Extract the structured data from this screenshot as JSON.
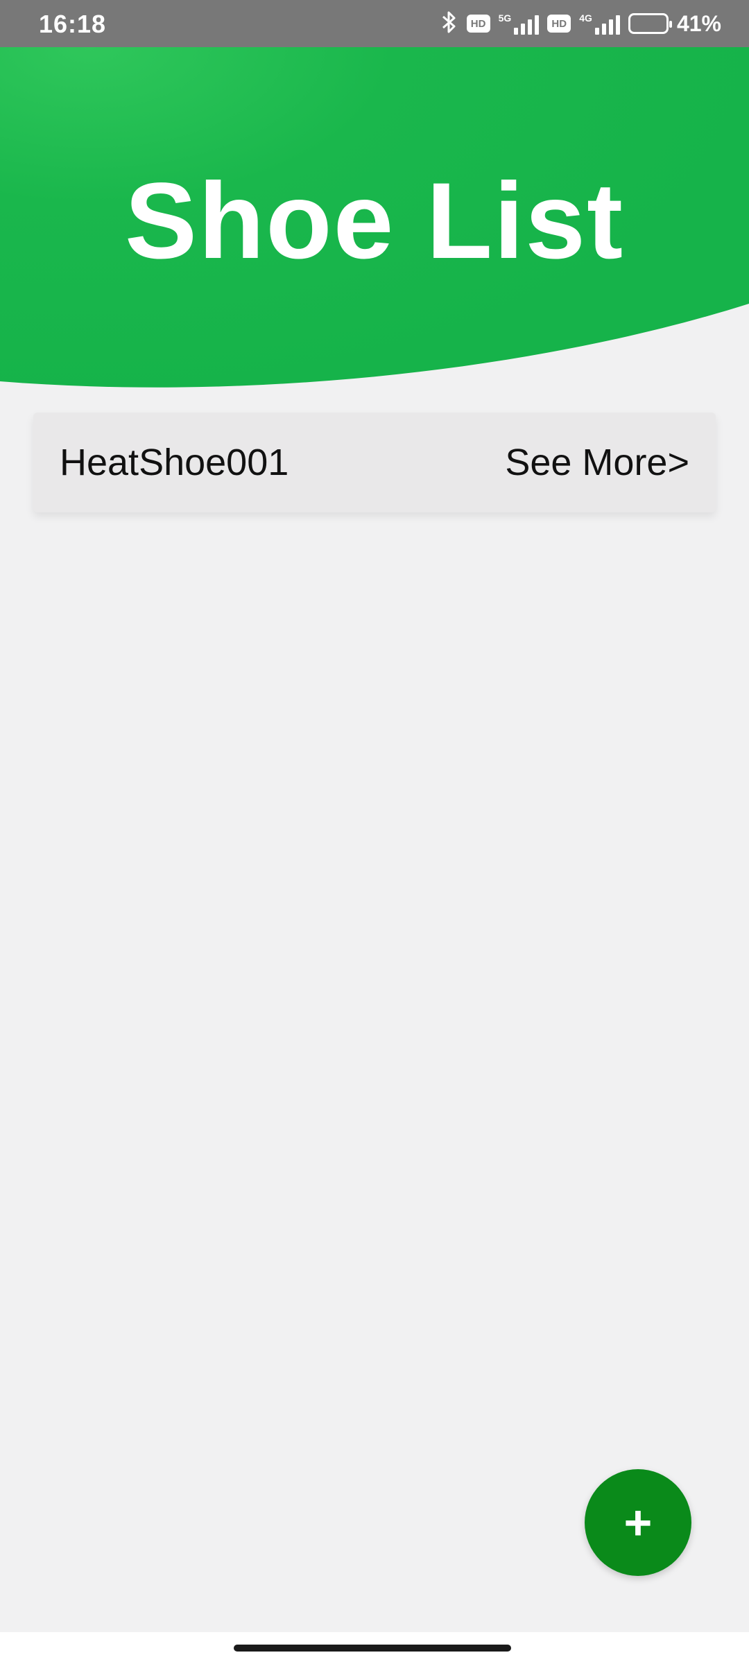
{
  "status_bar": {
    "time": "16:18",
    "hd_label_1": "HD",
    "net_label_1": "5G",
    "hd_label_2": "HD",
    "net_label_2": "4G",
    "battery_text": "41%",
    "battery_level_percent": 41
  },
  "header": {
    "title": "Shoe List",
    "color": "#16b34a"
  },
  "list": {
    "items": [
      {
        "name": "HeatShoe001",
        "action": "See More>"
      }
    ]
  },
  "fab": {
    "label": "+",
    "color": "#0a8a1a"
  }
}
